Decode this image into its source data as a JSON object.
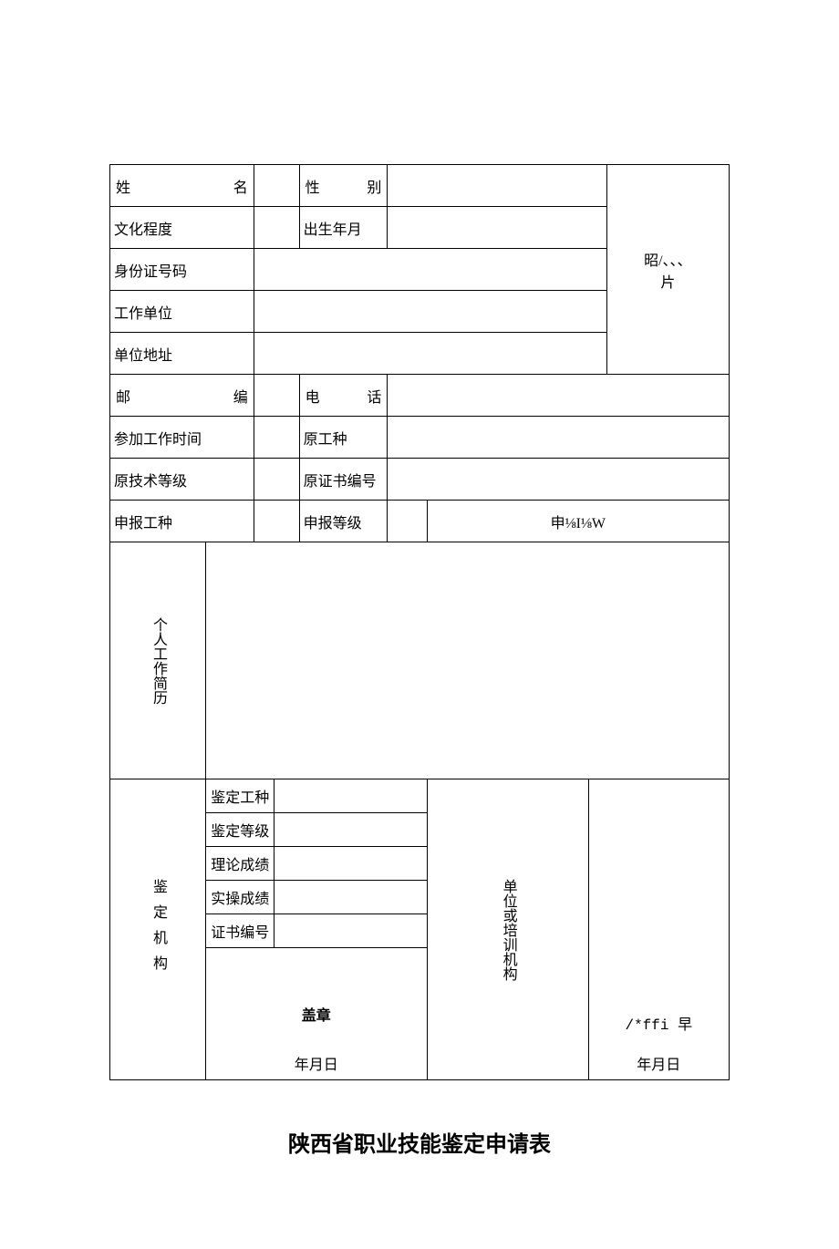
{
  "labels": {
    "name": "姓 名",
    "gender": "性 别",
    "education": "文化程度",
    "birth": "出生年月",
    "photo_line1": "昭/、、、",
    "photo_line2": "片",
    "id_number": "身份证号码",
    "work_unit": "工作单位",
    "unit_address": "单位地址",
    "postcode": "邮 编",
    "phone": "电 话",
    "start_work": "参加工作时间",
    "orig_job": "原工种",
    "orig_level": "原技术等级",
    "orig_certno": "原证书编号",
    "apply_job": "申报工种",
    "apply_level": "申报等级",
    "apply_category": "申⅛I⅛W",
    "resume": "个人工作简历",
    "org": "鉴定机构",
    "jd_job": "鉴定工种",
    "jd_level": "鉴定等级",
    "score_theory": "理论成绩",
    "score_practice": "实操成绩",
    "certno": "证书编号",
    "unit_or_training": "单位或培训机构",
    "seal": "盖章",
    "seal2": "/*ffi 早",
    "date": "年月日"
  },
  "title": "陕西省职业技能鉴定申请表"
}
